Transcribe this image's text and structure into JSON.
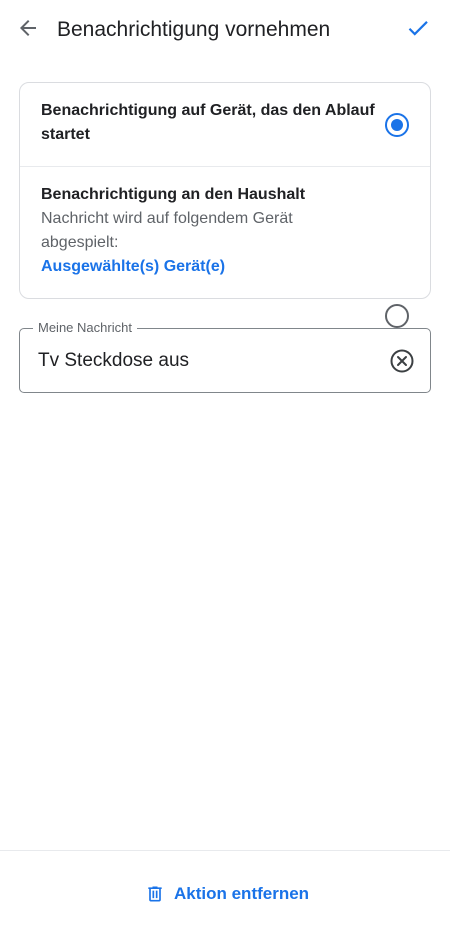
{
  "appbar": {
    "title": "Benachrichtigung vornehmen",
    "back_icon": "arrow-back-icon",
    "confirm_icon": "check-icon"
  },
  "options": [
    {
      "title": "Benachrichtigung auf Gerät, das den Ablauf startet",
      "selected": true
    },
    {
      "title": "Benachrichtigung an den Haushalt",
      "description": "Nachricht wird auf folgendem Gerät abgespielt:",
      "link": "Ausgewählte(s) Gerät(e)",
      "selected": false
    }
  ],
  "message_field": {
    "label": "Meine Nachricht",
    "value": "Tv Steckdose aus",
    "clear_icon": "clear-circle-icon"
  },
  "bottom_action": {
    "label": "Aktion entfernen",
    "icon": "trash-icon"
  },
  "colors": {
    "accent": "#1a73e8",
    "text_primary": "#202124",
    "text_secondary": "#5f6368",
    "divider": "#dadce0"
  }
}
